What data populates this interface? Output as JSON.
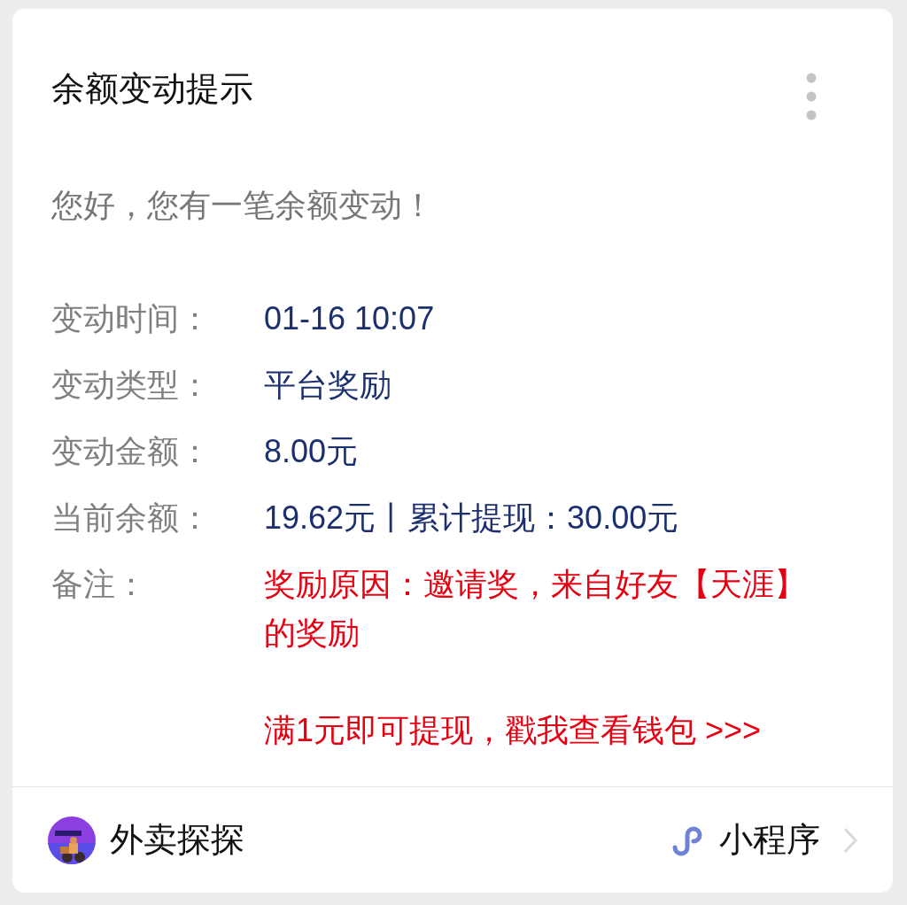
{
  "title": "余额变动提示",
  "greeting": "您好，您有一笔余额变动！",
  "rows": [
    {
      "label": "变动时间：",
      "value": "01-16 10:07",
      "kind": "normal"
    },
    {
      "label": "变动类型：",
      "value": "平台奖励",
      "kind": "normal"
    },
    {
      "label": "变动金额：",
      "value": "8.00元",
      "kind": "normal"
    },
    {
      "label": "当前余额：",
      "value": "19.62元丨累计提现：30.00元",
      "kind": "normal"
    },
    {
      "label": "备注：",
      "value": "奖励原因：邀请奖，来自好友【天涯】的奖励",
      "kind": "alert"
    }
  ],
  "action_link": "满1元即可提现，戳我查看钱包 >>>",
  "footer": {
    "app_name": "外卖探探",
    "tag": "小程序"
  }
}
